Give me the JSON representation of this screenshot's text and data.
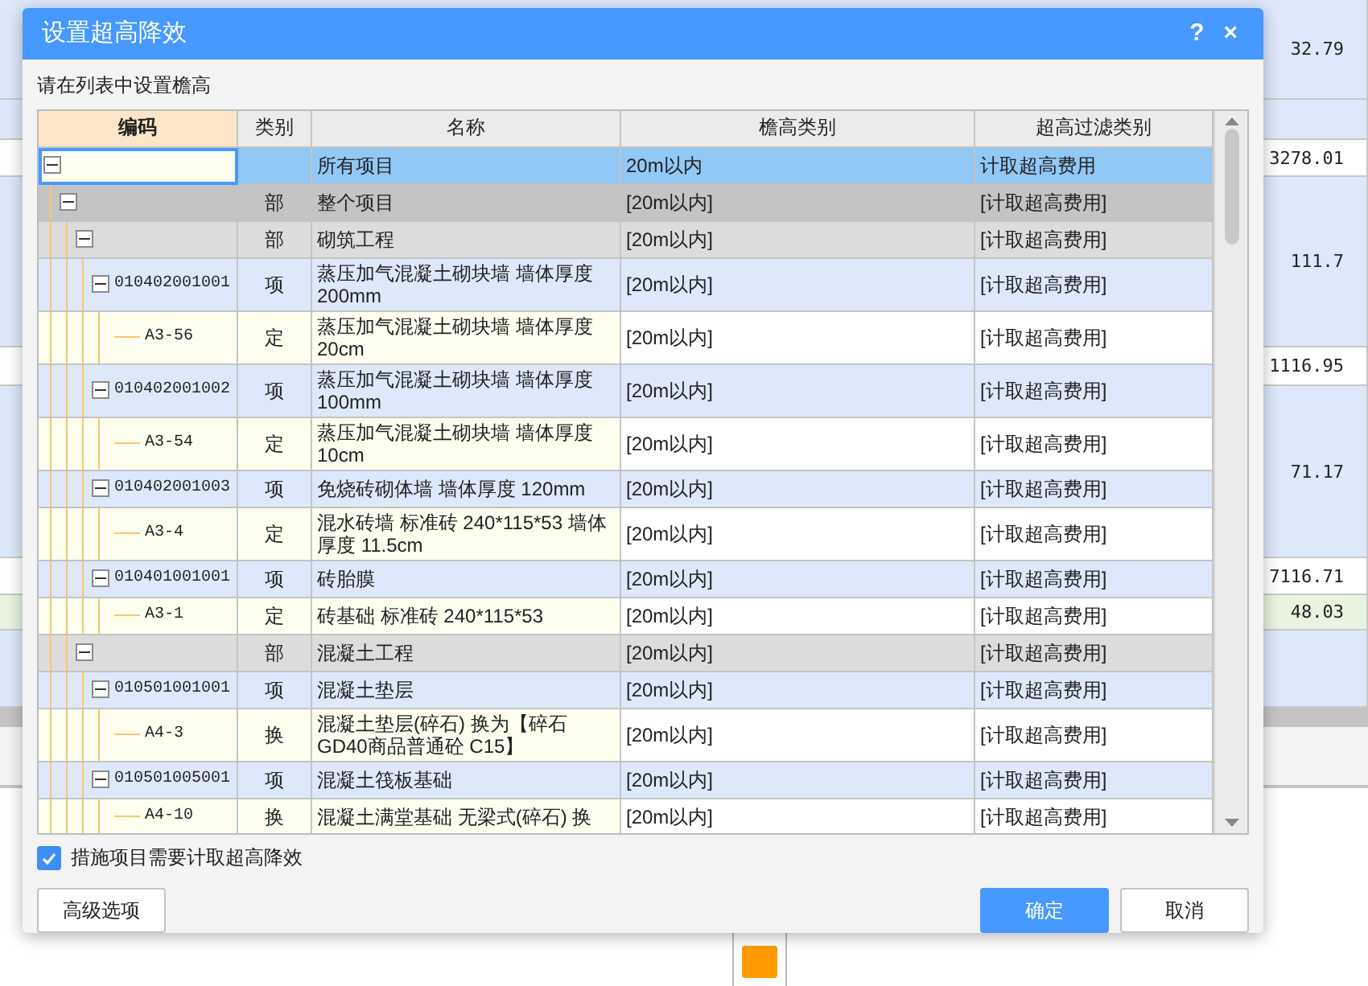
{
  "background": {
    "rows": [
      {
        "value": "32.79",
        "kind": "tinted"
      },
      {
        "value": "",
        "kind": "tinted"
      },
      {
        "value": "3278.01",
        "kind": "plain"
      },
      {
        "value": "111.7",
        "kind": "tinted"
      },
      {
        "value": "1116.95",
        "kind": "plain"
      },
      {
        "value": "71.17",
        "kind": "tinted"
      },
      {
        "value": "7116.71",
        "kind": "plain"
      },
      {
        "value": "48.03",
        "kind": "marked"
      },
      {
        "value": "",
        "kind": "tinted"
      }
    ]
  },
  "dialog": {
    "title": "设置超高降效",
    "help": "?",
    "close": "×",
    "instruction": "请在列表中设置檐高",
    "table": {
      "columns": [
        {
          "label": "编码",
          "selected": true
        },
        {
          "label": "类别",
          "selected": false
        },
        {
          "label": "名称",
          "selected": false
        },
        {
          "label": "檐高类别",
          "selected": false
        },
        {
          "label": "超高过滤类别",
          "selected": false
        }
      ],
      "rows": [
        {
          "kind": "root",
          "name": "所有项目",
          "height": "20m以内",
          "filter": "计取超高费用",
          "selected": true,
          "expanded": true,
          "children": [
            {
              "kind": "group",
              "type": "部",
              "name": "整个项目",
              "height": "[20m以内]",
              "filter": "[计取超高费用]",
              "selected": false,
              "expanded": true,
              "children": [
                {
                  "kind": "section",
                  "type": "部",
                  "name": "砌筑工程",
                  "height": "[20m以内]",
                  "filter": "[计取超高费用]",
                  "selected": false,
                  "expanded": true,
                  "children": [
                    {
                      "kind": "item",
                      "code": "010402001001",
                      "type": "项",
                      "name": "蒸压加气混凝土砌块墙 墙体厚度 200mm",
                      "height": "[20m以内]",
                      "filter": "[计取超高费用]",
                      "selected": false,
                      "expanded": true,
                      "children": [
                        {
                          "kind": "quota",
                          "code": "A3-56",
                          "type": "定",
                          "name": "蒸压加气混凝土砌块墙 墙体厚度 20cm",
                          "height": "[20m以内]",
                          "filter": "[计取超高费用]",
                          "selected": false
                        }
                      ]
                    },
                    {
                      "kind": "item",
                      "code": "010402001002",
                      "type": "项",
                      "name": "蒸压加气混凝土砌块墙 墙体厚度 100mm",
                      "height": "[20m以内]",
                      "filter": "[计取超高费用]",
                      "selected": false,
                      "expanded": true,
                      "children": [
                        {
                          "kind": "quota",
                          "code": "A3-54",
                          "type": "定",
                          "name": "蒸压加气混凝土砌块墙 墙体厚度 10cm",
                          "height": "[20m以内]",
                          "filter": "[计取超高费用]",
                          "selected": false
                        }
                      ]
                    },
                    {
                      "kind": "item",
                      "code": "010402001003",
                      "type": "项",
                      "name": "免烧砖砌体墙 墙体厚度 120mm",
                      "height": "[20m以内]",
                      "filter": "[计取超高费用]",
                      "selected": false,
                      "expanded": true,
                      "children": [
                        {
                          "kind": "quota",
                          "code": "A3-4",
                          "type": "定",
                          "name": "混水砖墙 标准砖 240*115*53 墙体厚度 11.5cm",
                          "height": "[20m以内]",
                          "filter": "[计取超高费用]",
                          "selected": false
                        }
                      ]
                    },
                    {
                      "kind": "item",
                      "code": "010401001001",
                      "type": "项",
                      "name": "砖胎膜",
                      "height": "[20m以内]",
                      "filter": "[计取超高费用]",
                      "selected": false,
                      "expanded": true,
                      "children": [
                        {
                          "kind": "quota",
                          "code": "A3-1",
                          "type": "定",
                          "name": "砖基础 标准砖 240*115*53",
                          "height": "[20m以内]",
                          "filter": "[计取超高费用]",
                          "selected": false
                        }
                      ]
                    }
                  ]
                },
                {
                  "kind": "section",
                  "type": "部",
                  "name": "混凝土工程",
                  "height": "[20m以内]",
                  "filter": "[计取超高费用]",
                  "selected": false,
                  "expanded": true,
                  "children": [
                    {
                      "kind": "item",
                      "code": "010501001001",
                      "type": "项",
                      "name": "混凝土垫层",
                      "height": "[20m以内]",
                      "filter": "[计取超高费用]",
                      "selected": false,
                      "expanded": true,
                      "children": [
                        {
                          "kind": "quota",
                          "code": "A4-3",
                          "type": "换",
                          "name": "混凝土垫层(碎石)  换为【碎石 GD40商品普通砼 C15】",
                          "height": "[20m以内]",
                          "filter": "[计取超高费用]",
                          "selected": false
                        }
                      ]
                    },
                    {
                      "kind": "item",
                      "code": "010501005001",
                      "type": "项",
                      "name": "混凝土筏板基础",
                      "height": "[20m以内]",
                      "filter": "[计取超高费用]",
                      "selected": false,
                      "expanded": true,
                      "children": [
                        {
                          "kind": "quota",
                          "code": "A4-10",
                          "type": "换",
                          "name": "混凝土满堂基础 无梁式(碎石) 换",
                          "height": "[20m以内]",
                          "filter": "[计取超高费用]",
                          "selected": false
                        }
                      ]
                    }
                  ]
                }
              ]
            }
          ]
        }
      ]
    },
    "measures_checkbox": {
      "label": "措施项目需要计取超高降效",
      "checked": true
    },
    "buttons": [
      {
        "label": "高级选项",
        "kind": "secondary"
      },
      {
        "label": "确定",
        "kind": "primary"
      },
      {
        "label": "取消",
        "kind": "secondary"
      }
    ]
  }
}
